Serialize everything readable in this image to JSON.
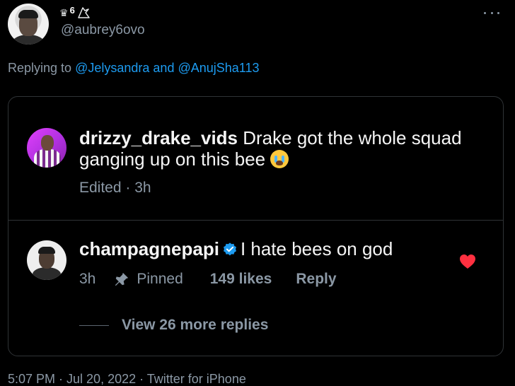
{
  "tweet": {
    "handle": "@aubrey6ovo",
    "name_suffix": "6",
    "replying_prefix": "Replying to",
    "reply_target_1": "@Jelysandra",
    "reply_and": "and",
    "reply_target_2": "@AnujSha113",
    "footer": "5:07 PM · Jul 20, 2022 · Twitter for iPhone"
  },
  "comment1": {
    "username": "drizzy_drake_vids",
    "text": "Drake got the whole squad ganging up on this bee",
    "meta": "Edited · 3h"
  },
  "comment2": {
    "username": "champagnepapi",
    "text": "I hate bees on god",
    "time": "3h",
    "pinned": "Pinned",
    "likes": "149 likes",
    "reply": "Reply",
    "view_more": "View 26 more replies"
  },
  "colors": {
    "background": "#000000",
    "link": "#1d9bf0",
    "muted": "#8b98a5",
    "heart": "#ff3040",
    "verified": "#1d9bf0"
  }
}
